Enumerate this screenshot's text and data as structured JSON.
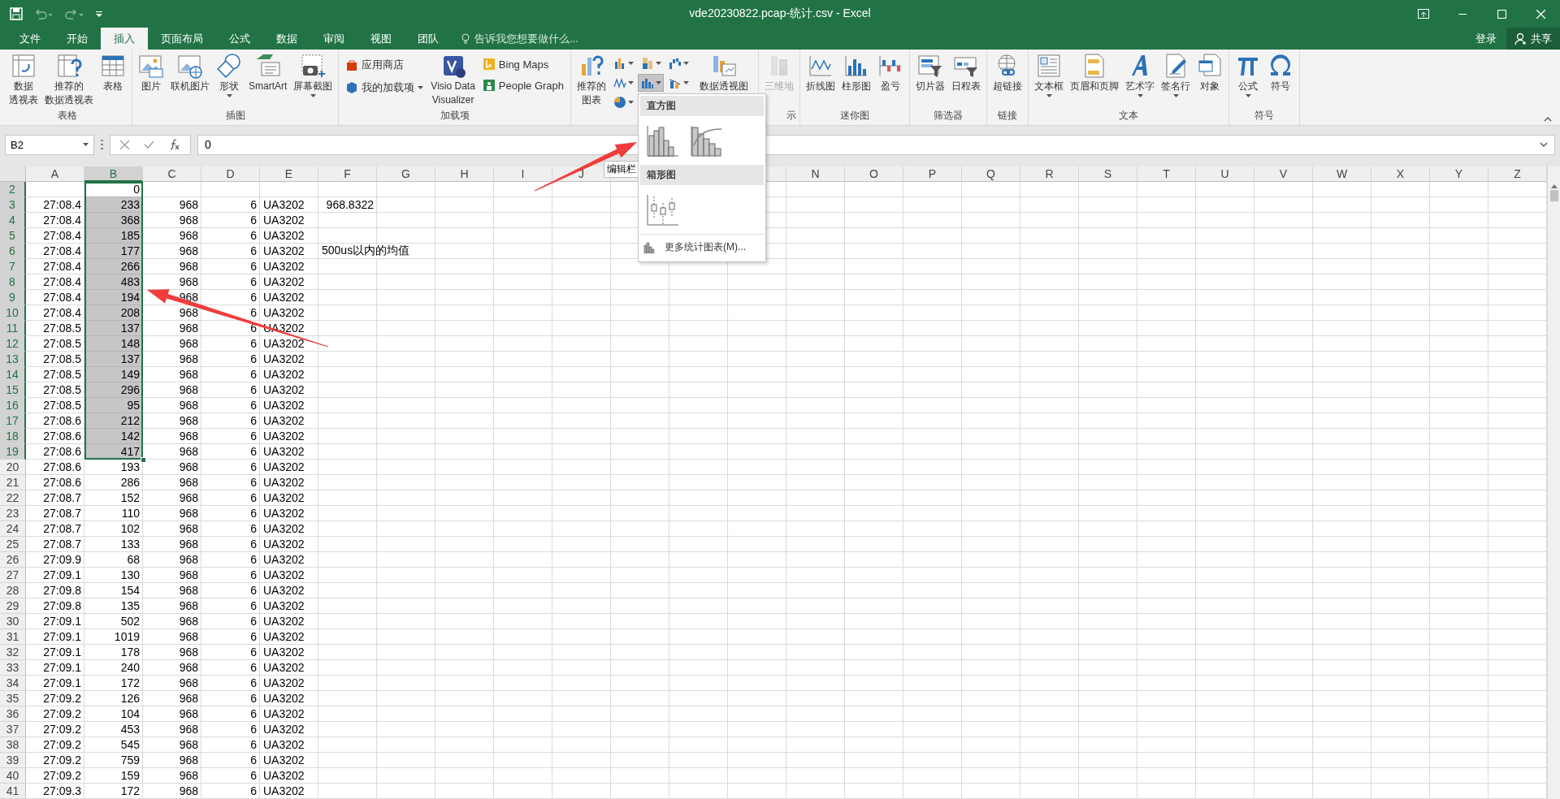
{
  "window": {
    "title": "vde20230822.pcap-统计.csv - Excel"
  },
  "tabs": [
    {
      "label": "文件",
      "selected": false
    },
    {
      "label": "开始",
      "selected": false
    },
    {
      "label": "插入",
      "selected": true
    },
    {
      "label": "页面布局",
      "selected": false
    },
    {
      "label": "公式",
      "selected": false
    },
    {
      "label": "数据",
      "selected": false
    },
    {
      "label": "审阅",
      "selected": false
    },
    {
      "label": "视图",
      "selected": false
    },
    {
      "label": "团队",
      "selected": false
    }
  ],
  "tell_me": {
    "placeholder": "告诉我您想要做什么..."
  },
  "account": {
    "sign_in": "登录",
    "share": "共享"
  },
  "ribbon": {
    "groups": [
      {
        "label": "表格",
        "items": [
          {
            "kind": "large",
            "lines": [
              "数据",
              "透视表"
            ]
          },
          {
            "kind": "large",
            "lines": [
              "推荐的",
              "数据透视表"
            ]
          },
          {
            "kind": "large",
            "lines": [
              "表格"
            ]
          }
        ]
      },
      {
        "label": "插图",
        "items": [
          {
            "kind": "large",
            "lines": [
              "图片"
            ]
          },
          {
            "kind": "large",
            "lines": [
              "联机图片"
            ]
          },
          {
            "kind": "large",
            "lines": [
              "形状"
            ],
            "dropdown": true
          },
          {
            "kind": "large",
            "lines": [
              "SmartArt"
            ]
          },
          {
            "kind": "large",
            "lines": [
              "屏幕截图"
            ],
            "dropdown": true
          }
        ]
      },
      {
        "label": "加载项",
        "items": [
          {
            "kind": "stack",
            "buttons": [
              {
                "label": "应用商店"
              },
              {
                "label": "我的加载项",
                "dropdown": true
              }
            ]
          },
          {
            "kind": "large",
            "lines": [
              "Visio Data",
              "Visualizer"
            ]
          },
          {
            "kind": "stack",
            "buttons": [
              {
                "label": "Bing Maps"
              },
              {
                "label": "People Graph"
              }
            ]
          }
        ]
      },
      {
        "items": [
          {
            "kind": "large",
            "lines": [
              "推荐的",
              "图表"
            ]
          },
          {
            "kind": "grid",
            "buttons": [
              {
                "selected": false
              },
              {
                "selected": false
              },
              {
                "selected": false
              },
              {
                "selected": false
              },
              {
                "selected": true
              },
              {
                "selected": false
              },
              {
                "selected": false
              }
            ]
          },
          {
            "kind": "large",
            "lines": [
              "数据透视图"
            ]
          }
        ]
      },
      {
        "label": "示",
        "items": [
          {
            "kind": "large",
            "lines": [
              "三维地"
            ],
            "disabled": true
          }
        ]
      },
      {
        "label": "迷你图",
        "items": [
          {
            "kind": "large",
            "lines": [
              "折线图"
            ]
          },
          {
            "kind": "large",
            "lines": [
              "柱形图"
            ]
          },
          {
            "kind": "large",
            "lines": [
              "盈亏"
            ]
          }
        ]
      },
      {
        "label": "筛选器",
        "items": [
          {
            "kind": "large",
            "lines": [
              "切片器"
            ]
          },
          {
            "kind": "large",
            "lines": [
              "日程表"
            ]
          }
        ]
      },
      {
        "label": "链接",
        "items": [
          {
            "kind": "large",
            "lines": [
              "超链接"
            ]
          }
        ]
      },
      {
        "label": "文本",
        "items": [
          {
            "kind": "large",
            "lines": [
              "文本框"
            ],
            "dropdown": true
          },
          {
            "kind": "large",
            "lines": [
              "页眉和页脚"
            ]
          },
          {
            "kind": "large",
            "lines": [
              "艺术字"
            ],
            "dropdown": true
          },
          {
            "kind": "large",
            "lines": [
              "签名行"
            ],
            "dropdown": true
          },
          {
            "kind": "large",
            "lines": [
              "对象"
            ]
          }
        ]
      },
      {
        "label": "符号",
        "items": [
          {
            "kind": "large",
            "lines": [
              "公式"
            ],
            "dropdown": true
          },
          {
            "kind": "large",
            "lines": [
              "符号"
            ]
          }
        ]
      }
    ]
  },
  "chart_menu": {
    "sections": [
      {
        "title": "直方图",
        "charts": [
          {
            "kind": "histogram"
          },
          {
            "kind": "pareto"
          }
        ]
      },
      {
        "title": "箱形图",
        "charts": [
          {
            "kind": "box"
          }
        ]
      }
    ],
    "footer": "更多统计图表(M)..."
  },
  "tooltip": "编辑栏",
  "formula_bar": {
    "name_box": "B2",
    "value": "0"
  },
  "sheet": {
    "columns": [
      {
        "label": "A",
        "selected": false
      },
      {
        "label": "B",
        "selected": true
      },
      {
        "label": "C",
        "selected": false
      },
      {
        "label": "D",
        "selected": false
      },
      {
        "label": "E",
        "selected": false
      },
      {
        "label": "F",
        "selected": false
      },
      {
        "label": "G",
        "selected": false
      },
      {
        "label": "H",
        "selected": false
      },
      {
        "label": "I",
        "selected": false
      },
      {
        "label": "J",
        "selected": false
      },
      {},
      {},
      {},
      {
        "label": "N",
        "selected": false
      },
      {
        "label": "O",
        "selected": false
      },
      {
        "label": "P",
        "selected": false
      },
      {
        "label": "Q",
        "selected": false
      },
      {
        "label": "R",
        "selected": false
      },
      {
        "label": "S",
        "selected": false
      },
      {
        "label": "T",
        "selected": false
      },
      {
        "label": "U",
        "selected": false
      },
      {
        "label": "V",
        "selected": false
      },
      {
        "label": "W",
        "selected": false
      },
      {
        "label": "X",
        "selected": false
      },
      {
        "label": "Y",
        "selected": false
      },
      {
        "label": "Z",
        "selected": false
      }
    ],
    "rows": [
      {
        "row": "2",
        "selected": true,
        "active_value": "0"
      },
      {
        "row": "3",
        "selected": true,
        "values": [
          "27:08.4",
          "233",
          "968",
          "6",
          "UA3202"
        ],
        "F": {
          "kind": "number",
          "text": "968.8322"
        }
      },
      {
        "row": "4",
        "selected": true,
        "values": [
          "27:08.4",
          "368",
          "968",
          "6",
          "UA3202"
        ]
      },
      {
        "row": "5",
        "selected": true,
        "values": [
          "27:08.4",
          "185",
          "968",
          "6",
          "UA3202"
        ]
      },
      {
        "row": "6",
        "selected": true,
        "values": [
          "27:08.4",
          "177",
          "968",
          "6",
          "UA3202"
        ],
        "F": {
          "kind": "text",
          "text": "500us以内的均值"
        }
      },
      {
        "row": "7",
        "selected": true,
        "values": [
          "27:08.4",
          "266",
          "968",
          "6",
          "UA3202"
        ]
      },
      {
        "row": "8",
        "selected": true,
        "values": [
          "27:08.4",
          "483",
          "968",
          "6",
          "UA3202"
        ]
      },
      {
        "row": "9",
        "selected": true,
        "values": [
          "27:08.4",
          "194",
          "968",
          "6",
          "UA3202"
        ]
      },
      {
        "row": "10",
        "selected": true,
        "values": [
          "27:08.4",
          "208",
          "968",
          "6",
          "UA3202"
        ]
      },
      {
        "row": "11",
        "selected": true,
        "values": [
          "27:08.5",
          "137",
          "968",
          "6",
          "UA3202"
        ]
      },
      {
        "row": "12",
        "selected": true,
        "values": [
          "27:08.5",
          "148",
          "968",
          "6",
          "UA3202"
        ]
      },
      {
        "row": "13",
        "selected": true,
        "values": [
          "27:08.5",
          "137",
          "968",
          "6",
          "UA3202"
        ]
      },
      {
        "row": "14",
        "selected": true,
        "values": [
          "27:08.5",
          "149",
          "968",
          "6",
          "UA3202"
        ]
      },
      {
        "row": "15",
        "selected": true,
        "values": [
          "27:08.5",
          "296",
          "968",
          "6",
          "UA3202"
        ]
      },
      {
        "row": "16",
        "selected": true,
        "values": [
          "27:08.5",
          "95",
          "968",
          "6",
          "UA3202"
        ]
      },
      {
        "row": "17",
        "selected": true,
        "values": [
          "27:08.6",
          "212",
          "968",
          "6",
          "UA3202"
        ]
      },
      {
        "row": "18",
        "selected": true,
        "values": [
          "27:08.6",
          "142",
          "968",
          "6",
          "UA3202"
        ]
      },
      {
        "row": "19",
        "selected": true,
        "values": [
          "27:08.6",
          "417",
          "968",
          "6",
          "UA3202"
        ]
      },
      {
        "row": "20",
        "selected": false,
        "values": [
          "27:08.6",
          "193",
          "968",
          "6",
          "UA3202"
        ]
      },
      {
        "row": "21",
        "selected": false,
        "values": [
          "27:08.6",
          "286",
          "968",
          "6",
          "UA3202"
        ]
      },
      {
        "row": "22",
        "selected": false,
        "values": [
          "27:08.7",
          "152",
          "968",
          "6",
          "UA3202"
        ]
      },
      {
        "row": "23",
        "selected": false,
        "values": [
          "27:08.7",
          "110",
          "968",
          "6",
          "UA3202"
        ]
      },
      {
        "row": "24",
        "selected": false,
        "values": [
          "27:08.7",
          "102",
          "968",
          "6",
          "UA3202"
        ]
      },
      {
        "row": "25",
        "selected": false,
        "values": [
          "27:08.7",
          "133",
          "968",
          "6",
          "UA3202"
        ]
      },
      {
        "row": "26",
        "selected": false,
        "values": [
          "27:09.9",
          "68",
          "968",
          "6",
          "UA3202"
        ]
      },
      {
        "row": "27",
        "selected": false,
        "values": [
          "27:09.1",
          "130",
          "968",
          "6",
          "UA3202"
        ]
      },
      {
        "row": "28",
        "selected": false,
        "values": [
          "27:09.8",
          "154",
          "968",
          "6",
          "UA3202"
        ]
      },
      {
        "row": "29",
        "selected": false,
        "values": [
          "27:09.8",
          "135",
          "968",
          "6",
          "UA3202"
        ]
      },
      {
        "row": "30",
        "selected": false,
        "values": [
          "27:09.1",
          "502",
          "968",
          "6",
          "UA3202"
        ]
      },
      {
        "row": "31",
        "selected": false,
        "values": [
          "27:09.1",
          "1019",
          "968",
          "6",
          "UA3202"
        ]
      },
      {
        "row": "32",
        "selected": false,
        "values": [
          "27:09.1",
          "178",
          "968",
          "6",
          "UA3202"
        ]
      },
      {
        "row": "33",
        "selected": false,
        "values": [
          "27:09.1",
          "240",
          "968",
          "6",
          "UA3202"
        ]
      },
      {
        "row": "34",
        "selected": false,
        "values": [
          "27:09.1",
          "172",
          "968",
          "6",
          "UA3202"
        ]
      },
      {
        "row": "35",
        "selected": false,
        "values": [
          "27:09.2",
          "126",
          "968",
          "6",
          "UA3202"
        ]
      },
      {
        "row": "36",
        "selected": false,
        "values": [
          "27:09.2",
          "104",
          "968",
          "6",
          "UA3202"
        ]
      },
      {
        "row": "37",
        "selected": false,
        "values": [
          "27:09.2",
          "453",
          "968",
          "6",
          "UA3202"
        ]
      },
      {
        "row": "38",
        "selected": false,
        "values": [
          "27:09.2",
          "545",
          "968",
          "6",
          "UA3202"
        ]
      },
      {
        "row": "39",
        "selected": false,
        "values": [
          "27:09.2",
          "759",
          "968",
          "6",
          "UA3202"
        ]
      },
      {
        "row": "40",
        "selected": false,
        "values": [
          "27:09.2",
          "159",
          "968",
          "6",
          "UA3202"
        ]
      },
      {
        "row": "41",
        "selected": false,
        "values": [
          "27:09.3",
          "172",
          "968",
          "6",
          "UA3202"
        ]
      }
    ]
  }
}
